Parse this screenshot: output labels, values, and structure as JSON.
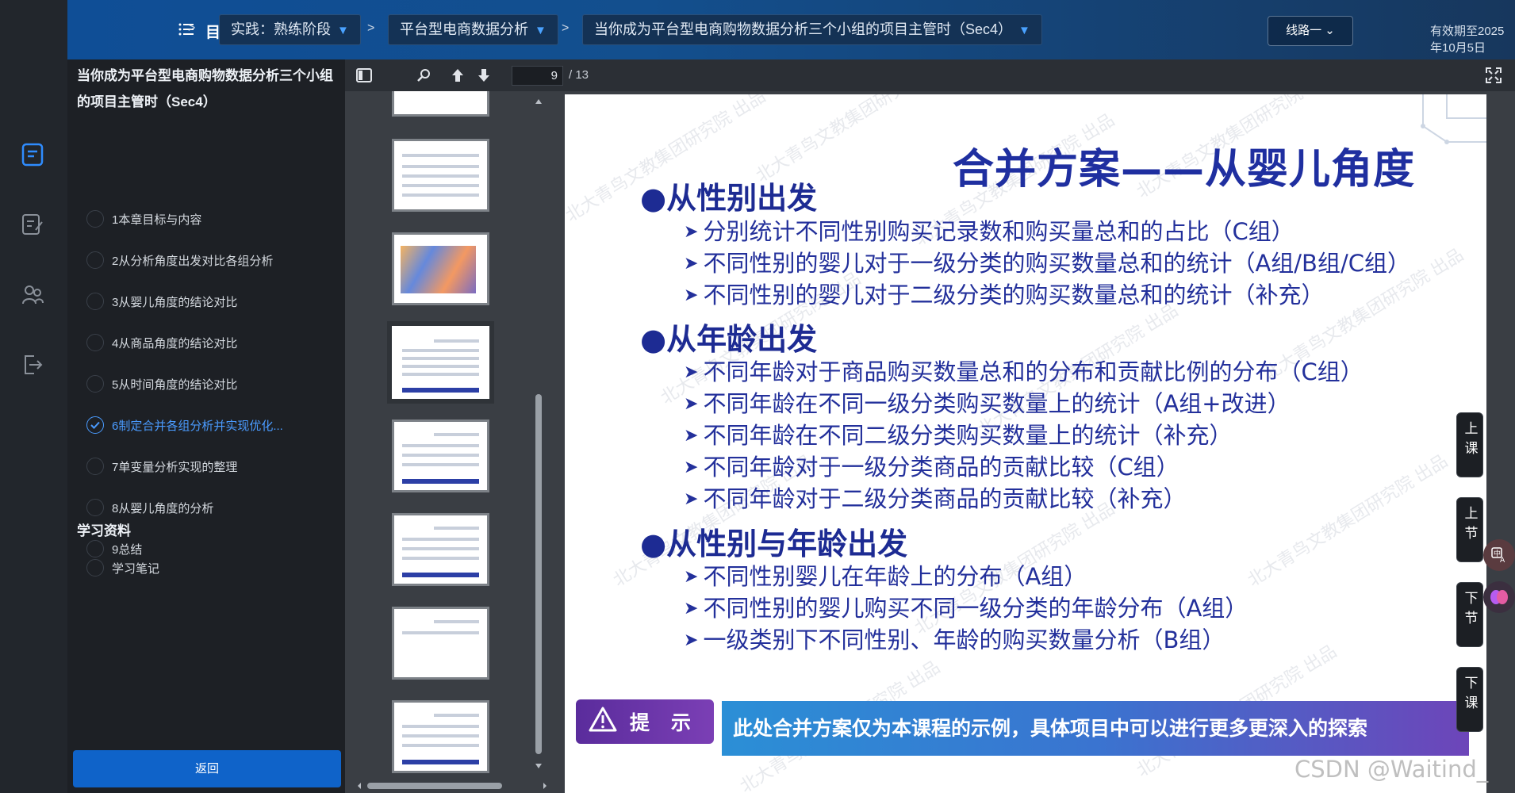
{
  "topbar": {
    "menu_label": "目录",
    "crumbs": [
      {
        "label": "实践：熟练阶段"
      },
      {
        "label": "平台型电商数据分析"
      },
      {
        "label": "当你成为平台型电商购物数据分析三个小组的项目主管时（Sec4）"
      }
    ],
    "route_label": "线路一",
    "expire_text": "有效期至2025年10月5日"
  },
  "sidebar": {
    "course_title": "当你成为平台型电商购物数据分析三个小组的项目主管时（Sec4）",
    "items": [
      {
        "label": "1本章目标与内容"
      },
      {
        "label": "2从分析角度出发对比各组分析"
      },
      {
        "label": "3从婴儿角度的结论对比"
      },
      {
        "label": "4从商品角度的结论对比"
      },
      {
        "label": "5从时间角度的结论对比"
      },
      {
        "label": "6制定合并各组分析并实现优化..."
      },
      {
        "label": "7单变量分析实现的整理"
      },
      {
        "label": "8从婴儿角度的分析"
      },
      {
        "label": "9总结"
      }
    ],
    "materials_heading": "学习资料",
    "materials": [
      {
        "label": "学习笔记"
      }
    ],
    "back_label": "返回"
  },
  "pdf": {
    "current_page": "9",
    "total_pages": "/ 13"
  },
  "slide": {
    "title": "合并方案——从婴儿角度",
    "sections": [
      {
        "heading": "●从性别出发",
        "lines": [
          "分别统计不同性别购买记录数和购买量总和的占比（C组）",
          "不同性别的婴儿对于一级分类的购买数量总和的统计（A组/B组/C组）",
          "不同性别的婴儿对于二级分类的购买数量总和的统计（补充）"
        ]
      },
      {
        "heading": "●从年龄出发",
        "lines": [
          "不同年龄对于商品购买数量总和的分布和贡献比例的分布（C组）",
          "不同年龄在不同一级分类购买数量上的统计（A组+改进）",
          "不同年龄在不同二级分类购买数量上的统计（补充）",
          "不同年龄对于一级分类商品的贡献比较（C组）",
          "不同年龄对于二级分类商品的贡献比较（补充）"
        ]
      },
      {
        "heading": "●从性别与年龄出发",
        "lines": [
          "不同性别婴儿在年龄上的分布（A组）",
          "不同性别的婴儿购买不同一级分类的年龄分布（A组）",
          "一级类别下不同性别、年龄的购买数量分析（B组）"
        ]
      }
    ],
    "tip_label": "提 示",
    "tip_text": "此处合并方案仅为本课程的示例，具体项目中可以进行更多更深入的探索",
    "watermark": "北大青鸟文教集团研究院 出品"
  },
  "side_nav": [
    {
      "label": "上课"
    },
    {
      "label": "上节"
    },
    {
      "label": "下节"
    },
    {
      "label": "下课"
    }
  ],
  "csdn_mark": "CSDN @Waitind_",
  "colors": {
    "accent": "#0f63c9",
    "active_item": "#4a9bff",
    "slide_text": "#23309b",
    "tip_purple": "#6b36ad"
  }
}
